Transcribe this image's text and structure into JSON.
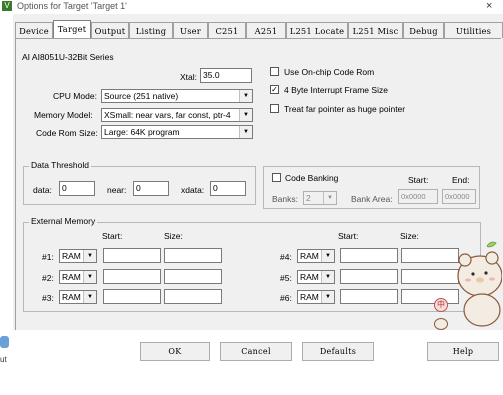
{
  "window": {
    "title": "Options for Target 'Target 1'",
    "close_glyph": "×",
    "app_icon_glyph": "V"
  },
  "tabs": [
    "Device",
    "Target",
    "Output",
    "Listing",
    "User",
    "C251",
    "A251",
    "L251 Locate",
    "L251 Misc",
    "Debug",
    "Utilities"
  ],
  "active_tab": "Target",
  "device": {
    "name": "AI AI8051U-32Bit Series"
  },
  "xtal": {
    "label": "Xtal:",
    "value": "35.0"
  },
  "cpu_mode": {
    "label": "CPU Mode:",
    "value": "Source (251 native)"
  },
  "memory_model": {
    "label": "Memory Model:",
    "value": "XSmall: near vars, far const, ptr-4"
  },
  "code_rom_size": {
    "label": "Code Rom Size:",
    "value": "Large: 64K program"
  },
  "options": [
    {
      "label": "Use On-chip Code Rom",
      "checked": false
    },
    {
      "label": "4 Byte Interrupt Frame Size",
      "checked": true
    },
    {
      "label": "Treat far pointer as huge pointer",
      "checked": false
    }
  ],
  "check_glyph": "✓",
  "combo_arrow": "▼",
  "data_threshold": {
    "title": "Data Threshold",
    "data_label": "data:",
    "data_value": "0",
    "near_label": "near:",
    "near_value": "0",
    "xdata_label": "xdata:",
    "xdata_value": "0"
  },
  "code_banking": {
    "label": "Code Banking",
    "start_header": "Start:",
    "end_header": "End:",
    "banks_label": "Banks:",
    "banks_value": "2",
    "bank_area_label": "Bank Area:",
    "start_value": "0x0000",
    "end_value": "0x0000"
  },
  "external_memory": {
    "title": "External Memory",
    "start_header": "Start:",
    "size_header": "Size:",
    "rows_left": [
      {
        "label": "#1:",
        "type": "RAM"
      },
      {
        "label": "#2:",
        "type": "RAM"
      },
      {
        "label": "#3:",
        "type": "RAM"
      }
    ],
    "rows_right": [
      {
        "label": "#4:",
        "type": "RAM"
      },
      {
        "label": "#5:",
        "type": "RAM"
      },
      {
        "label": "#6:",
        "type": "RAM"
      }
    ]
  },
  "buttons": {
    "ok": "OK",
    "cancel": "Cancel",
    "defaults": "Defaults",
    "help": "Help"
  },
  "background": {
    "cut_text": "ut"
  },
  "sticker": {
    "badge_text": "中"
  },
  "colors": {
    "dialog_bg": "#f0f0f0",
    "border": "#7a7a7a",
    "sticker_body": "#f3ece2",
    "sticker_outline": "#8a5a3a"
  }
}
